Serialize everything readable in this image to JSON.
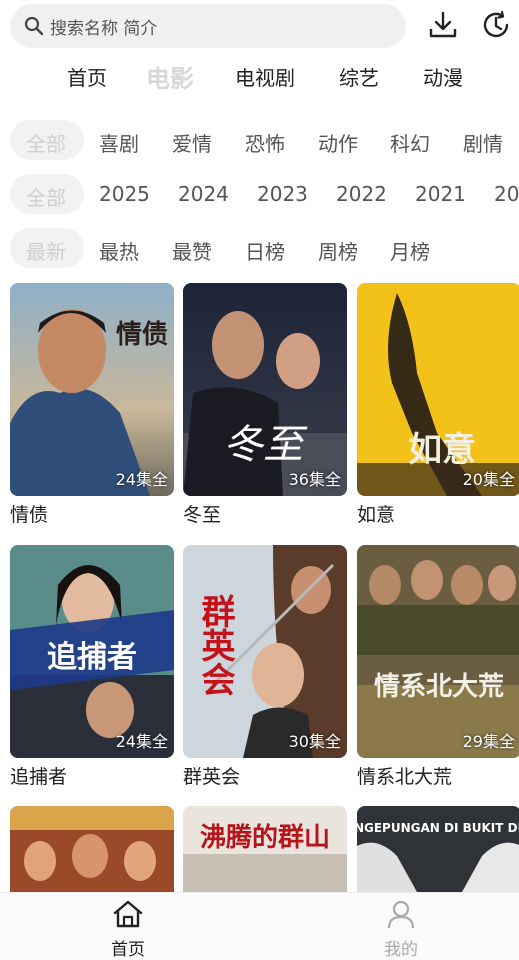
{
  "search": {
    "placeholder": "搜索名称 简介"
  },
  "nav": [
    "首页",
    "电影",
    "电视剧",
    "综艺",
    "动漫"
  ],
  "genres": [
    "全部",
    "喜剧",
    "爱情",
    "恐怖",
    "动作",
    "科幻",
    "剧情"
  ],
  "years": [
    "全部",
    "2025",
    "2024",
    "2023",
    "2022",
    "2021",
    "20"
  ],
  "sorts": [
    "最新",
    "最热",
    "最赞",
    "日榜",
    "周榜",
    "月榜"
  ],
  "items": [
    {
      "title": "情债",
      "episodes": "24集全",
      "poster_text": "情债"
    },
    {
      "title": "冬至",
      "episodes": "36集全",
      "poster_text": "冬至"
    },
    {
      "title": "如意",
      "episodes": "20集全",
      "poster_text": "如意"
    },
    {
      "title": "追捕者",
      "episodes": "24集全",
      "poster_text": "追捕者"
    },
    {
      "title": "群英会",
      "episodes": "30集全",
      "poster_text": "群英会"
    },
    {
      "title": "情系北大荒",
      "episodes": "29集全",
      "poster_text": "情系北大荒"
    }
  ],
  "partial_posters": [
    {
      "poster_text": ""
    },
    {
      "poster_text": "沸腾的群山"
    },
    {
      "poster_text": "PENGEPUNGAN DI BUKIT DURI"
    }
  ],
  "tabs": [
    {
      "label": "首页",
      "icon": "home-icon",
      "active": true
    },
    {
      "label": "我的",
      "icon": "user-icon",
      "active": false
    }
  ],
  "colors": {
    "active_tab": "#222222",
    "inactive": "#aaaaaa",
    "muted_pill": "#f2f2f2"
  }
}
